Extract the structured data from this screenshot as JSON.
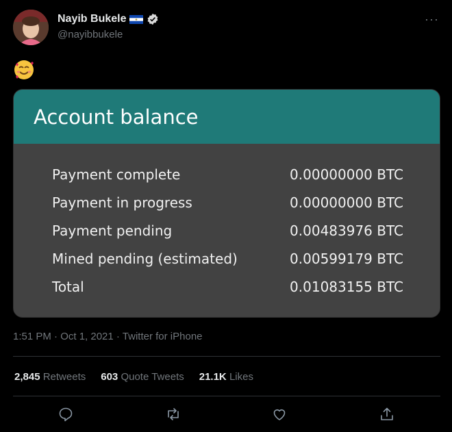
{
  "tweet": {
    "author_name": "Nayib Bukele",
    "author_handle": "@nayibbukele",
    "more_label": "···",
    "emoji_icon": "smiling-face-with-hearts-icon",
    "timestamp": "1:51 PM · Oct 1, 2021 · Twitter for iPhone"
  },
  "card": {
    "title": "Account balance",
    "header_color": "#1f7a78",
    "rows": [
      {
        "label": "Payment complete",
        "value": "0.00000000 BTC"
      },
      {
        "label": "Payment in progress",
        "value": "0.00000000 BTC"
      },
      {
        "label": "Payment pending",
        "value": "0.00483976 BTC"
      },
      {
        "label": "Mined pending (estimated)",
        "value": "0.00599179 BTC"
      },
      {
        "label": "Total",
        "value": "0.01083155 BTC"
      }
    ]
  },
  "stats": {
    "retweets_count": "2,845",
    "retweets_label": "Retweets",
    "quotes_count": "603",
    "quotes_label": "Quote Tweets",
    "likes_count": "21.1K",
    "likes_label": "Likes"
  },
  "actions": [
    "reply-icon",
    "retweet-icon",
    "like-icon",
    "share-icon"
  ]
}
